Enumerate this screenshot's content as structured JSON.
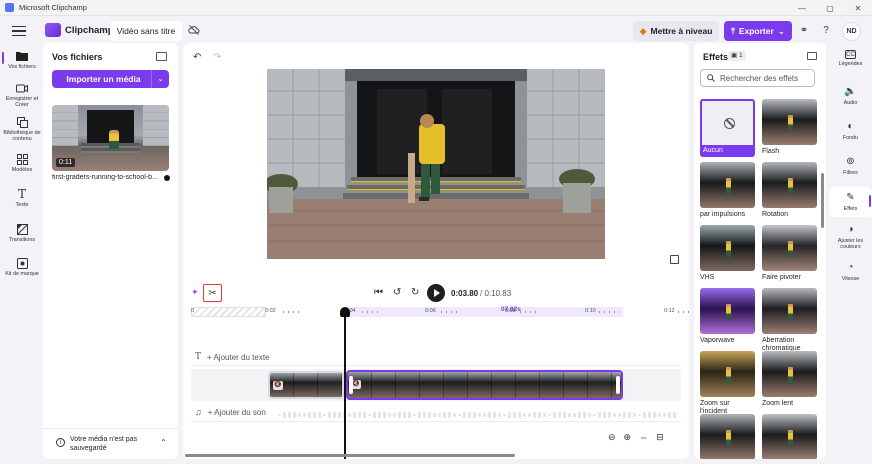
{
  "window": {
    "title": "Microsoft Clipchamp",
    "controls": [
      "—",
      "▢",
      "✕"
    ]
  },
  "header": {
    "brand": "Clipchamp",
    "project_tab": "Vidéo sans titre",
    "upgrade_label": "Mettre à niveau",
    "export_label": "Exporter",
    "avatar_initials": "ND",
    "accent": "#7c3aed"
  },
  "left_rail": [
    {
      "label": "Vos fichiers",
      "icon": "folder-icon"
    },
    {
      "label": "Enregistrer et Créer",
      "icon": "camera-icon"
    },
    {
      "label": "Bibliothèque de contenu",
      "icon": "library-icon"
    },
    {
      "label": "Modèles",
      "icon": "templates-icon"
    },
    {
      "label": "Texte",
      "icon": "text-icon"
    },
    {
      "label": "Transitions",
      "icon": "transitions-icon"
    },
    {
      "label": "Kit de marque",
      "icon": "brand-kit-icon"
    }
  ],
  "media": {
    "title": "Vos fichiers",
    "import_label": "Importer un média",
    "file": {
      "duration": "0:11",
      "name": "first-graders-running-to-school-b..."
    },
    "save_notice": "Votre média n'est pas sauvegardé"
  },
  "playback": {
    "current_time": "0:03.80",
    "total_time": "/ 0:10.83"
  },
  "ruler": {
    "ticks": [
      {
        "label": "0",
        "pos": 0
      },
      {
        "label": "0:02",
        "pos": 0.152
      },
      {
        "label": "0:04",
        "pos": 0.314
      },
      {
        "label": "0:06",
        "pos": 0.478
      },
      {
        "label": "07.02s",
        "pos": 0.633,
        "highlight": true
      },
      {
        "label": "0:08",
        "pos": 0.64
      },
      {
        "label": "0:10",
        "pos": 0.804
      },
      {
        "label": "0:12",
        "pos": 0.966
      }
    ]
  },
  "timeline": {
    "text_track_label": "+ Ajouter du texte",
    "audio_track_label": "+ Ajouter du son"
  },
  "effects": {
    "title": "Effets",
    "count": "1",
    "search_placeholder": "Rechercher des effets",
    "items": [
      {
        "label": "Aucun",
        "selected": true
      },
      {
        "label": "Flash"
      },
      {
        "label": "par impulsions"
      },
      {
        "label": "Rotation"
      },
      {
        "label": "VHS"
      },
      {
        "label": "Faire pivoter"
      },
      {
        "label": "Vaporwave"
      },
      {
        "label": "Aberration chromatique"
      },
      {
        "label": "Zoom sur l'incident"
      },
      {
        "label": "Zoom lent"
      },
      {
        "label": ""
      },
      {
        "label": ""
      }
    ]
  },
  "right_rail": [
    {
      "label": "Légendes",
      "icon": "captions-icon"
    },
    {
      "label": "Audio",
      "icon": "audio-icon"
    },
    {
      "label": "Fondu",
      "icon": "fade-icon"
    },
    {
      "label": "Filtres",
      "icon": "filters-icon"
    },
    {
      "label": "Effets",
      "icon": "effects-icon",
      "active": true
    },
    {
      "label": "Ajuster les couleurs",
      "icon": "adjust-colors-icon"
    },
    {
      "label": "Vitesse",
      "icon": "speed-icon"
    }
  ]
}
